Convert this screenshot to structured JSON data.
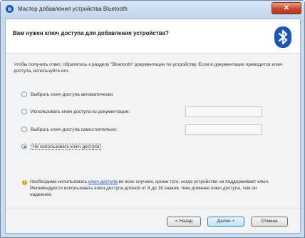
{
  "window": {
    "title": "Мастер добавления устройства Bluetooth",
    "close_symbol": "✕"
  },
  "header": {
    "title": "Вам нужен ключ доступа для добавления устройства?",
    "icon": "bluetooth-icon"
  },
  "instruction": "Чтобы получить ответ, обратитесь к разделу \"Bluetooth\" документации по устройству. Если в документации приводится ключ доступа, используйте его.",
  "options": [
    {
      "label": "Выбрать ключ доступа автоматически",
      "checked": false,
      "has_field": false
    },
    {
      "label": "Использовать ключ доступа из документации:",
      "checked": false,
      "has_field": true,
      "value": ""
    },
    {
      "label": "Выбрать ключ доступа самостоятельно:",
      "checked": false,
      "has_field": true,
      "value": ""
    },
    {
      "label": "Не использовать ключ доступа",
      "checked": true,
      "has_field": false
    }
  ],
  "note": {
    "before_link": "Необходимо использовать ",
    "link": "ключ доступа",
    "after_link": " во всех случаях, кроме того, когда устройство не поддерживает ключ. Рекомендуется использовать ключ доступа длиной от 8 до 16 знаков. Чем длиннее ключ доступа, тем он надежнее.",
    "icon": "warning-icon"
  },
  "buttons": {
    "back": "< Назад",
    "next": "Далее >",
    "cancel": "Отмена"
  },
  "colors": {
    "accent": "#2a6ed0",
    "link": "#1a4fc9",
    "bluetooth": "#1d56b8"
  }
}
